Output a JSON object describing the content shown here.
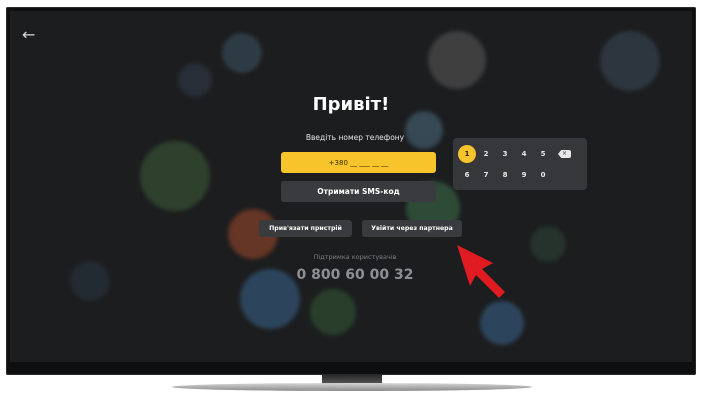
{
  "screen": {
    "back_icon": "←",
    "title": "Привіт!",
    "prompt": "Введіть номер телефону",
    "phone_value": "+380 __ ___ __ __",
    "sms_button": "Отримати SMS-код",
    "bind_device_button": "Прив'язати пристрій",
    "partner_login_button": "Увійти через партнера",
    "support_label": "Підтримка користувачів",
    "support_phone": "0 800 60 00 32"
  },
  "keypad": {
    "row1": [
      "1",
      "2",
      "3",
      "4",
      "5"
    ],
    "row2": [
      "6",
      "7",
      "8",
      "9",
      "0"
    ],
    "active_key": "1",
    "backspace_icon": "backspace-icon"
  },
  "colors": {
    "accent": "#f7c42c",
    "background": "#1c1d1f",
    "button": "#3a3b3e",
    "arrow": "#e11b22"
  }
}
